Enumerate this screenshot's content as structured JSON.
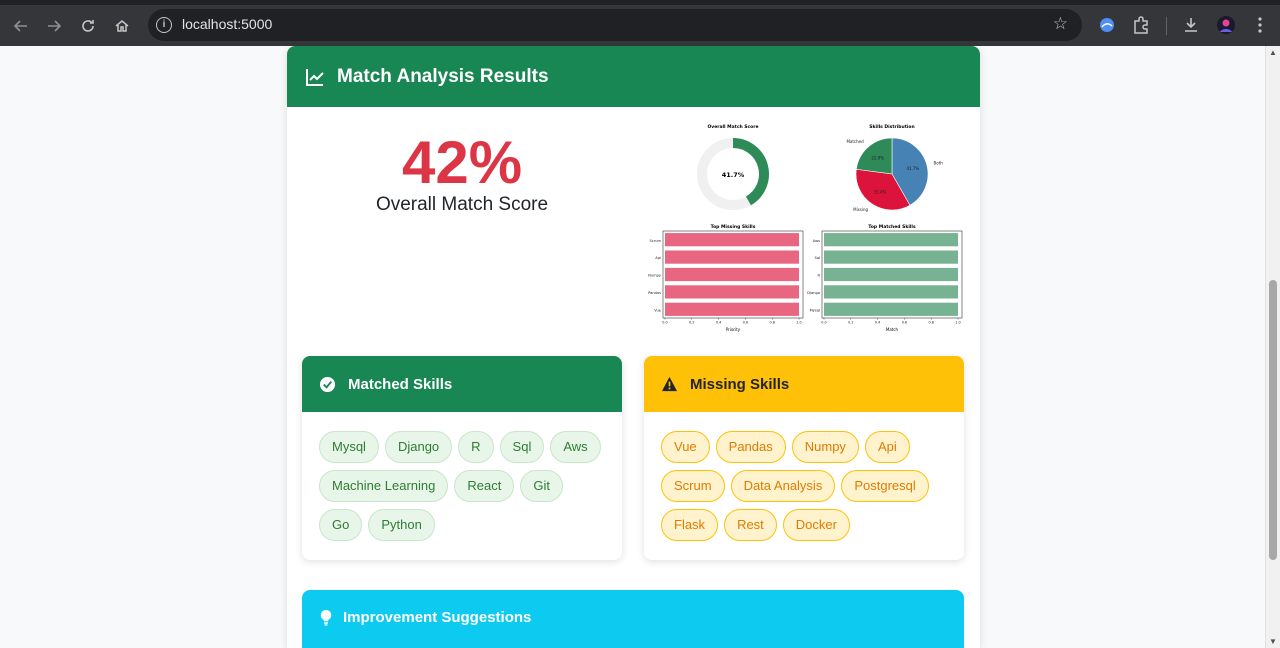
{
  "browser": {
    "url": "localhost:5000"
  },
  "header": {
    "title": "Match Analysis Results"
  },
  "score": {
    "value": "42%",
    "label": "Overall Match Score"
  },
  "charts": {
    "donut": {
      "title": "Overall Match Score",
      "label": "41.7%",
      "value": 41.7
    },
    "pie": {
      "title": "Skills Distribution",
      "slices": [
        {
          "name": "Both",
          "percent": 41.7,
          "color": "#4682b4",
          "label": "41.7%"
        },
        {
          "name": "Missing",
          "percent": 35.4,
          "color": "#dc143c",
          "label": "35.4%"
        },
        {
          "name": "Matched",
          "percent": 22.9,
          "color": "#2e8b57",
          "label": "22.9%"
        }
      ]
    },
    "missing_bar": {
      "title": "Top Missing Skills",
      "categories": [
        "Scrum",
        "Api",
        "Numpy",
        "Pandas",
        "Vue"
      ],
      "values": [
        1,
        1,
        1,
        1,
        1
      ],
      "xlabel": "Priority",
      "ticks": [
        "0.0",
        "0.2",
        "0.4",
        "0.6",
        "0.8",
        "1.0"
      ],
      "color": "#dc143c"
    },
    "matched_bar": {
      "title": "Top Matched Skills",
      "categories": [
        "Aws",
        "Sql",
        "R",
        "Django",
        "Mysql"
      ],
      "values": [
        1,
        1,
        1,
        1,
        1
      ],
      "xlabel": "Match",
      "ticks": [
        "0.0",
        "0.2",
        "0.4",
        "0.6",
        "0.8",
        "1.0"
      ],
      "color": "#2e8b57"
    }
  },
  "chart_data": [
    {
      "type": "pie",
      "title": "Overall Match Score",
      "values": [
        41.7,
        58.3
      ],
      "labels": [
        "41.7%"
      ]
    },
    {
      "type": "pie",
      "title": "Skills Distribution",
      "categories": [
        "Both",
        "Missing",
        "Matched"
      ],
      "values": [
        41.7,
        35.4,
        22.9
      ]
    },
    {
      "type": "bar",
      "title": "Top Missing Skills",
      "categories": [
        "Scrum",
        "Api",
        "Numpy",
        "Pandas",
        "Vue"
      ],
      "values": [
        1,
        1,
        1,
        1,
        1
      ],
      "xlabel": "Priority",
      "ylim": [
        0,
        1
      ]
    },
    {
      "type": "bar",
      "title": "Top Matched Skills",
      "categories": [
        "Aws",
        "Sql",
        "R",
        "Django",
        "Mysql"
      ],
      "values": [
        1,
        1,
        1,
        1,
        1
      ],
      "xlabel": "Match",
      "ylim": [
        0,
        1
      ]
    }
  ],
  "matched": {
    "title": "Matched Skills",
    "skills": [
      "Mysql",
      "Django",
      "R",
      "Sql",
      "Aws",
      "Machine Learning",
      "React",
      "Git",
      "Go",
      "Python"
    ]
  },
  "missing": {
    "title": "Missing Skills",
    "skills": [
      "Vue",
      "Pandas",
      "Numpy",
      "Api",
      "Scrum",
      "Data Analysis",
      "Postgresql",
      "Flask",
      "Rest",
      "Docker"
    ]
  },
  "improvement": {
    "title": "Improvement Suggestions"
  }
}
